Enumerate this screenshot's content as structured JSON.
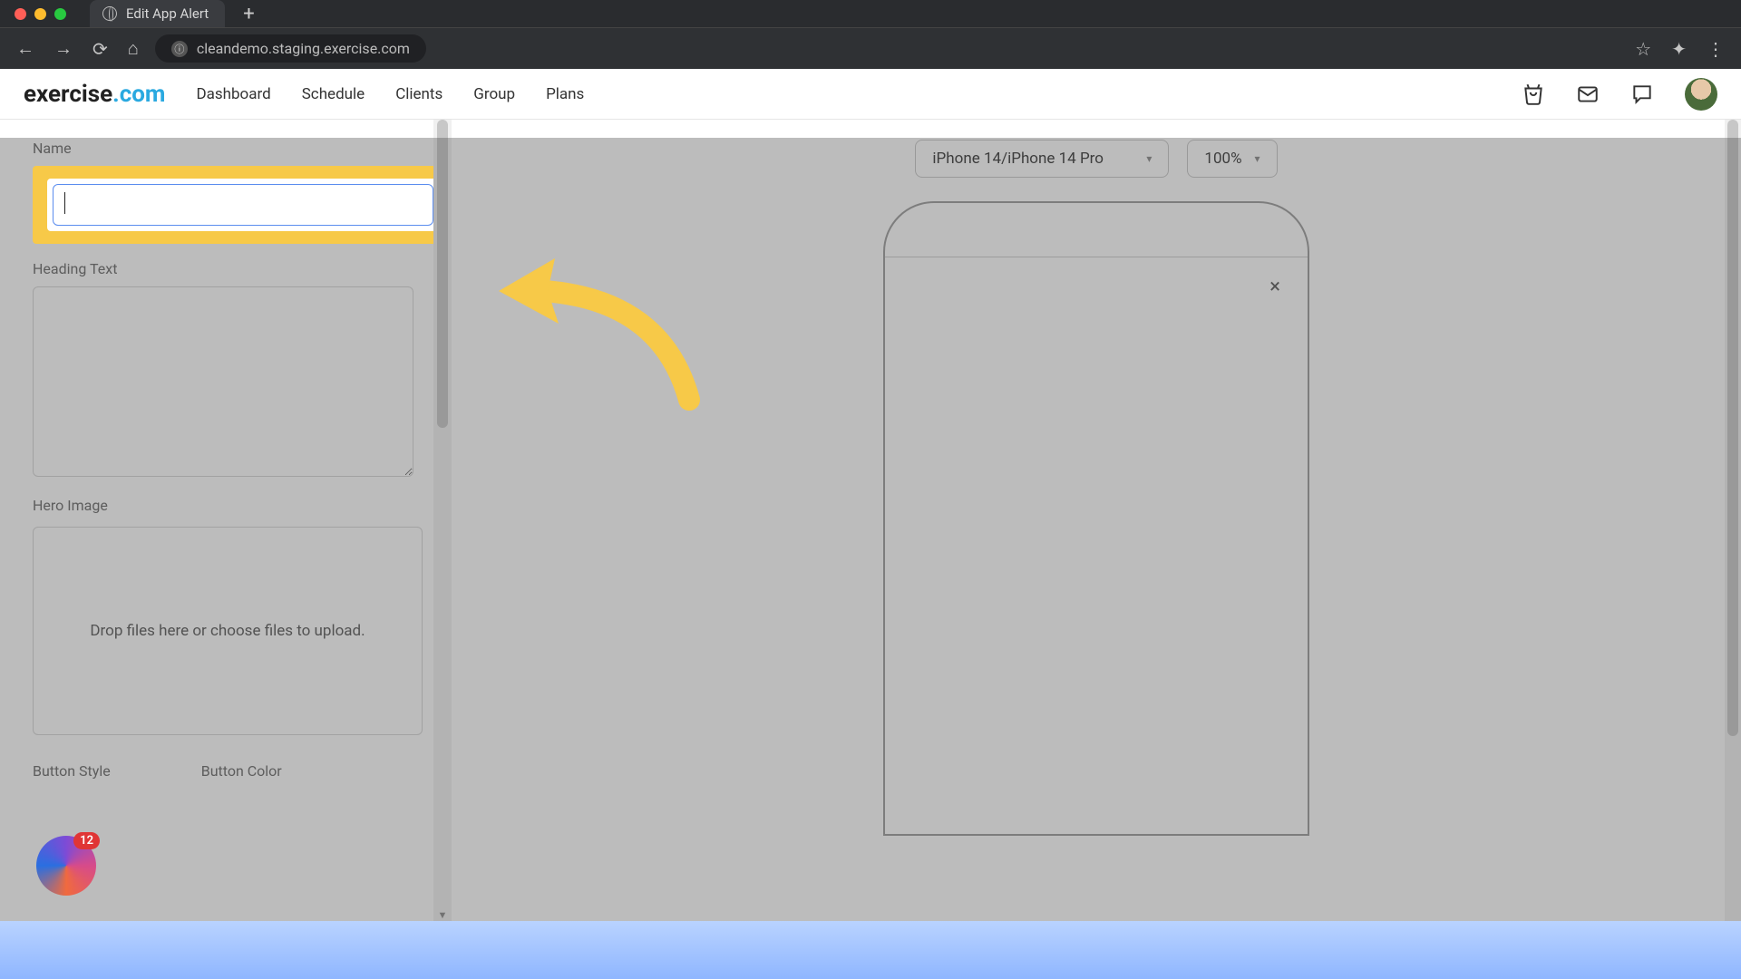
{
  "browser": {
    "tab_title": "Edit App Alert",
    "url": "cleandemo.staging.exercise.com"
  },
  "brand": {
    "name": "exercise",
    "suffix": ".com"
  },
  "nav": {
    "items": [
      "Dashboard",
      "Schedule",
      "Clients",
      "Group",
      "Plans"
    ]
  },
  "sidebar": {
    "name_label": "Name",
    "name_value": "",
    "heading_label": "Heading Text",
    "heading_value": "",
    "hero_label": "Hero Image",
    "hero_drop_text": "Drop files here or choose files to upload.",
    "button_style_label": "Button Style",
    "button_color_label": "Button Color"
  },
  "preview": {
    "device_label": "iPhone 14/iPhone 14 Pro",
    "zoom_label": "100%"
  },
  "widget": {
    "badge": "12"
  },
  "icons": {
    "star": "☆",
    "ext": "✦",
    "kebab": "⋮",
    "shopping": "🛍",
    "mail": "✉",
    "chat": "💬",
    "close": "×",
    "caret": "▾",
    "up": "▲",
    "down": "▼",
    "plus": "+"
  }
}
